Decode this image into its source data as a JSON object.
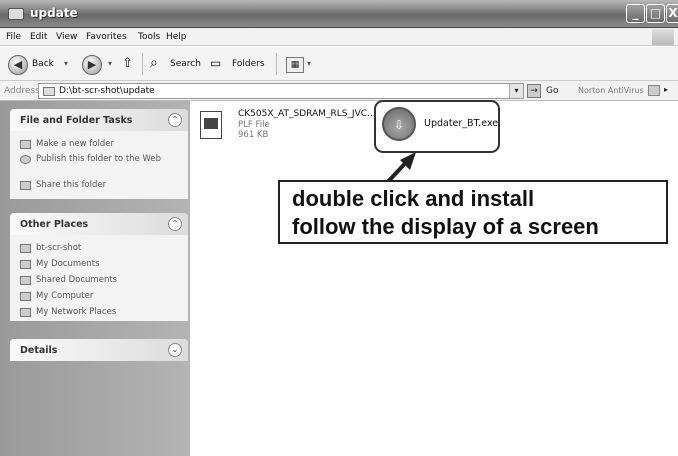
{
  "window": {
    "title": "update"
  },
  "menu": [
    "File",
    "Edit",
    "View",
    "Favorites",
    "Tools",
    "Help"
  ],
  "toolbar": {
    "back_label": "Back",
    "search_label": "Search",
    "folders_label": "Folders"
  },
  "address": {
    "label": "Address",
    "path": "D:\\bt-scr-shot\\update",
    "go_label": "Go",
    "antivirus_label": "Norton AntiVirus"
  },
  "left": {
    "file_tasks": {
      "title": "File and Folder Tasks",
      "items": [
        "Make a new folder",
        "Publish this folder to the Web",
        "Share this folder"
      ]
    },
    "other_places": {
      "title": "Other Places",
      "items": [
        "bt-scr-shot",
        "My Documents",
        "Shared Documents",
        "My Computer",
        "My Network Places"
      ]
    },
    "details": {
      "title": "Details"
    }
  },
  "files": [
    {
      "name": "CK505X_AT_SDRAM_RLS_JVC...",
      "type": "PLF File",
      "size": "961 KB"
    },
    {
      "name": "Updater_BT.exe"
    }
  ],
  "annotation": {
    "line1": "double click and install",
    "line2": "follow the display of a screen"
  }
}
